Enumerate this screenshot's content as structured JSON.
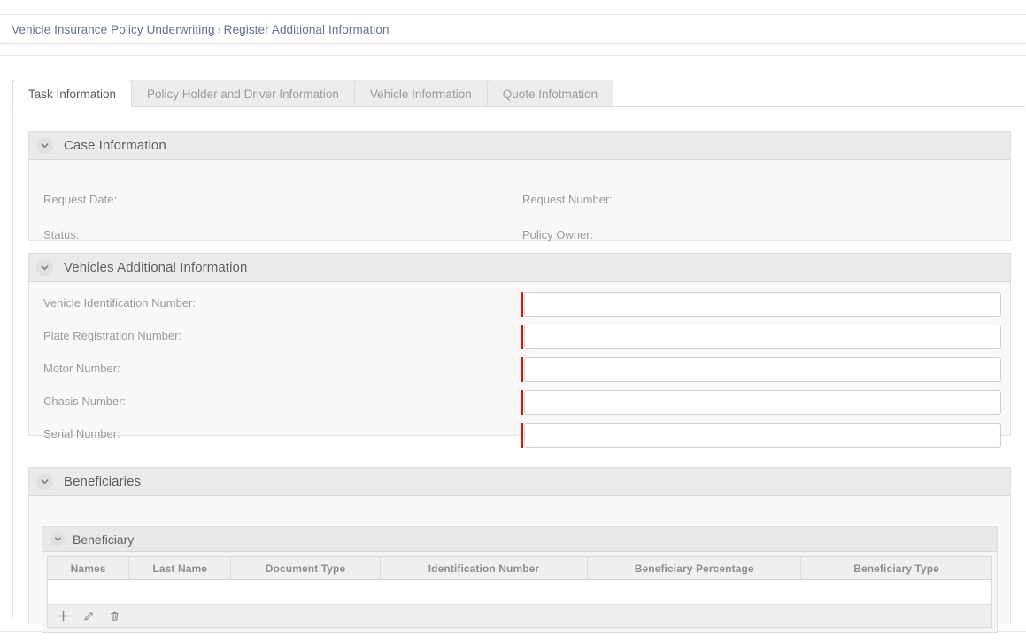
{
  "breadcrumb": {
    "root": "Vehicle Insurance Policy Underwriting",
    "separator": "›",
    "current": "Register Additional Information"
  },
  "tabs": [
    {
      "label": "Task Information",
      "active": true
    },
    {
      "label": "Policy Holder and Driver Information",
      "active": false
    },
    {
      "label": "Vehicle Information",
      "active": false
    },
    {
      "label": "Quote Infotmation",
      "active": false
    }
  ],
  "sections": {
    "case_information": {
      "title": "Case Information",
      "chevron_icon": "chevron-down-icon",
      "fields": [
        {
          "label": "Request Date:",
          "value": ""
        },
        {
          "label": "Request Number:",
          "value": ""
        },
        {
          "label": "Status:",
          "value": ""
        },
        {
          "label": "Policy Owner:",
          "value": ""
        }
      ]
    },
    "vehicles_additional_information": {
      "title": "Vehicles Additional Information",
      "chevron_icon": "chevron-down-icon",
      "fields": [
        {
          "label": "Vehicle Identification Number:",
          "value": "",
          "placeholder": "",
          "required": true
        },
        {
          "label": "Plate Registration Number:",
          "value": "",
          "placeholder": "",
          "required": true
        },
        {
          "label": "Motor Number:",
          "value": "",
          "placeholder": "",
          "required": true
        },
        {
          "label": "Chasis Number:",
          "value": "",
          "placeholder": "",
          "required": true
        },
        {
          "label": "Serial Number:",
          "value": "",
          "placeholder": "",
          "required": true
        }
      ]
    },
    "beneficiaries": {
      "title": "Beneficiaries",
      "chevron_icon": "chevron-down-icon",
      "inner_panel": {
        "title": "Beneficiary",
        "chevron_icon": "chevron-down-icon",
        "table": {
          "columns": [
            "Names",
            "Last Name",
            "Document Type",
            "Identification Number",
            "Beneficiary Percentage",
            "Beneficiary Type"
          ],
          "rows": []
        },
        "toolbar": [
          {
            "name": "add-row-button",
            "icon": "plus-icon"
          },
          {
            "name": "edit-row-button",
            "icon": "pencil-icon"
          },
          {
            "name": "delete-row-button",
            "icon": "trash-icon"
          }
        ]
      }
    }
  },
  "colors": {
    "required_marker": "#d41313",
    "section_header_bg": "#eaeaea",
    "section_body_bg": "#f8f8f8",
    "breadcrumb_text": "#63728a",
    "active_tab_bg": "#ffffff"
  }
}
